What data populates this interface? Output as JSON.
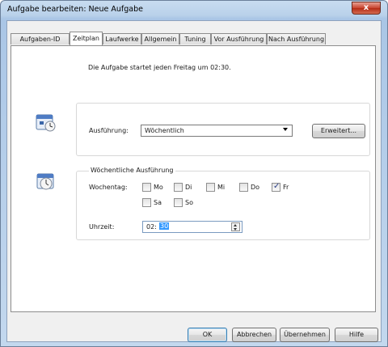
{
  "window": {
    "title": "Aufgabe bearbeiten: Neue Aufgabe",
    "close_label": "x"
  },
  "tabs": [
    {
      "label": "Aufgaben-ID"
    },
    {
      "label": "Zeitplan"
    },
    {
      "label": "Laufwerke"
    },
    {
      "label": "Allgemein"
    },
    {
      "label": "Tuning"
    },
    {
      "label": "Vor Ausführung"
    },
    {
      "label": "Nach Ausführung"
    }
  ],
  "active_tab": "Zeitplan",
  "schedule": {
    "intro": "Die Aufgabe startet jeden Freitag um 02:30.",
    "execution_label": "Ausführung:",
    "execution_value": "Wöchentlich",
    "advanced_button": "Erweitert...",
    "weekly_group_label": "Wöchentliche Ausführung",
    "weekday_label": "Wochentag:",
    "days": [
      {
        "label": "Mo",
        "checked": false
      },
      {
        "label": "Di",
        "checked": false
      },
      {
        "label": "Mi",
        "checked": false
      },
      {
        "label": "Do",
        "checked": false
      },
      {
        "label": "Fr",
        "checked": true
      },
      {
        "label": "Sa",
        "checked": false
      },
      {
        "label": "So",
        "checked": false
      }
    ],
    "time_label": "Uhrzeit:",
    "time_hours": "02:",
    "time_minutes": "30"
  },
  "footer": {
    "ok": "OK",
    "cancel": "Abbrechen",
    "apply": "Übernehmen",
    "help": "Hilfe"
  },
  "colors": {
    "accent": "#3399ff",
    "close": "#c8432e"
  }
}
